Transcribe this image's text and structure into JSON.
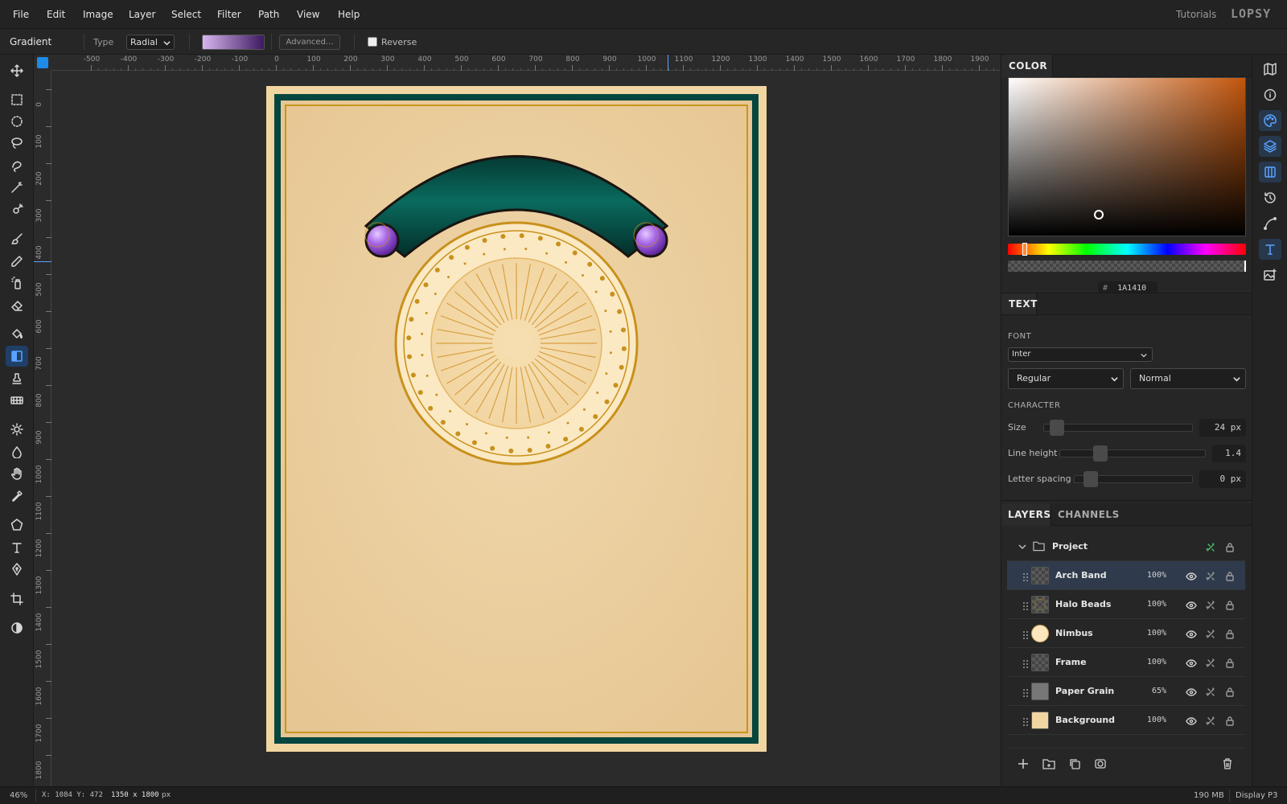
{
  "menu": [
    "File",
    "Edit",
    "Image",
    "Layer",
    "Select",
    "Filter",
    "Path",
    "View",
    "Help"
  ],
  "header": {
    "tutorials": "Tutorials",
    "logo": "LOPSY"
  },
  "options": {
    "tool_name": "Gradient",
    "type_label": "Type",
    "type_value": "Radial",
    "advanced_label": "Advanced...",
    "reverse_label": "Reverse",
    "reverse_checked": false,
    "gradient_start": "#d7b6ef",
    "gradient_end": "#3c1960"
  },
  "tools": [
    "move-icon",
    "rect-select-icon",
    "ellipse-select-icon",
    "lasso-icon",
    "object-select-icon",
    "magic-wand-icon",
    "quick-select-icon",
    "brush-icon",
    "pencil-icon",
    "spray-icon",
    "eraser-icon",
    "bucket-icon",
    "gradient-icon",
    "stamp-icon",
    "pattern-icon",
    "dodge-icon",
    "blur-icon",
    "hand-icon",
    "eyedropper-icon",
    "polygon-icon",
    "text-tool-icon",
    "pen-icon",
    "crop-icon",
    "contrast-icon"
  ],
  "active_tool": "gradient-icon",
  "ruler": {
    "h": [
      "-500",
      "-400",
      "-300",
      "-200",
      "-100",
      "0",
      "100",
      "200",
      "300",
      "400",
      "500",
      "600",
      "700",
      "800",
      "900",
      "1000",
      "1100",
      "1200",
      "1300",
      "1400",
      "1500",
      "1600",
      "1700",
      "1800",
      "1900"
    ],
    "v": [
      "0",
      "100",
      "200",
      "300",
      "400",
      "500",
      "600",
      "700",
      "800",
      "900",
      "1000",
      "1100",
      "1200",
      "1300",
      "1400",
      "1500",
      "1600",
      "1700",
      "1800"
    ]
  },
  "color_panel": {
    "title": "COLOR",
    "hex_prefix": "#",
    "hex": "1A1410"
  },
  "text_panel": {
    "title": "TEXT",
    "font_label": "FONT",
    "font_family": "Inter",
    "font_weight": "Regular",
    "font_style": "Normal",
    "character_label": "CHARACTER",
    "size_label": "Size",
    "size_value": "24 px",
    "line_height_label": "Line height",
    "line_height_value": "1.4",
    "letter_spacing_label": "Letter spacing",
    "letter_spacing_value": "0 px"
  },
  "layers_panel": {
    "tab_layers": "LAYERS",
    "tab_channels": "CHANNELS",
    "group": "Project",
    "layers": [
      {
        "name": "Arch Band",
        "opacity": "100%",
        "thumb": "checker"
      },
      {
        "name": "Halo Beads",
        "opacity": "100%",
        "thumb": "checker-ring"
      },
      {
        "name": "Nimbus",
        "opacity": "100%",
        "thumb": "disc"
      },
      {
        "name": "Frame",
        "opacity": "100%",
        "thumb": "checker"
      },
      {
        "name": "Paper Grain",
        "opacity": "65%",
        "thumb": "gray"
      },
      {
        "name": "Background",
        "opacity": "100%",
        "thumb": "cream"
      }
    ],
    "selected_layer": "Arch Band"
  },
  "right_icons": [
    "map-icon",
    "info-icon",
    "palette-icon",
    "layers-icon",
    "columns-icon",
    "history-icon",
    "curve-icon",
    "text-icon",
    "image-add-icon"
  ],
  "status": {
    "zoom": "46%",
    "coords": "X: 1084 Y: 472",
    "doc_size": "1350 x 1800",
    "doc_unit": "px",
    "memory": "190 MB",
    "color_profile": "Display P3"
  }
}
